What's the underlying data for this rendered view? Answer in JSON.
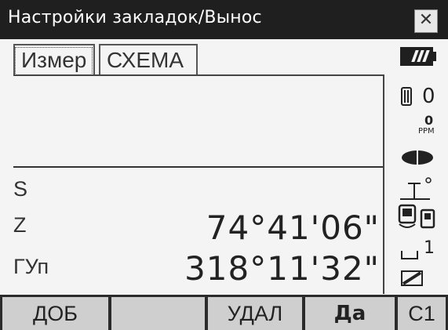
{
  "window": {
    "title": "Настройки закладок/Вынос",
    "close_glyph": "✕"
  },
  "tabs": [
    {
      "label": "Измер",
      "active": true
    },
    {
      "label": "СХЕМА",
      "active": false
    }
  ],
  "rows": [
    {
      "label": "S",
      "value": ""
    },
    {
      "label": "Z",
      "value": "74°41'06\""
    },
    {
      "label": "ГУп",
      "value": "318°11'32\""
    }
  ],
  "status": {
    "prism_constant": "0",
    "ppm_value": "0",
    "ppm_label": "PPM",
    "tilt_value": "1",
    "battery_level": 3,
    "icons": [
      "battery-icon",
      "prism-icon",
      "ppm-icon",
      "laser-target-icon",
      "instrument-height-icon",
      "bluetooth-device-icon",
      "tilt-icon",
      "edit-icon"
    ]
  },
  "softkeys": [
    {
      "label": "ДОБ"
    },
    {
      "label": ""
    },
    {
      "label": "УДАЛ"
    },
    {
      "label": "Да"
    },
    {
      "label": "C1"
    }
  ]
}
